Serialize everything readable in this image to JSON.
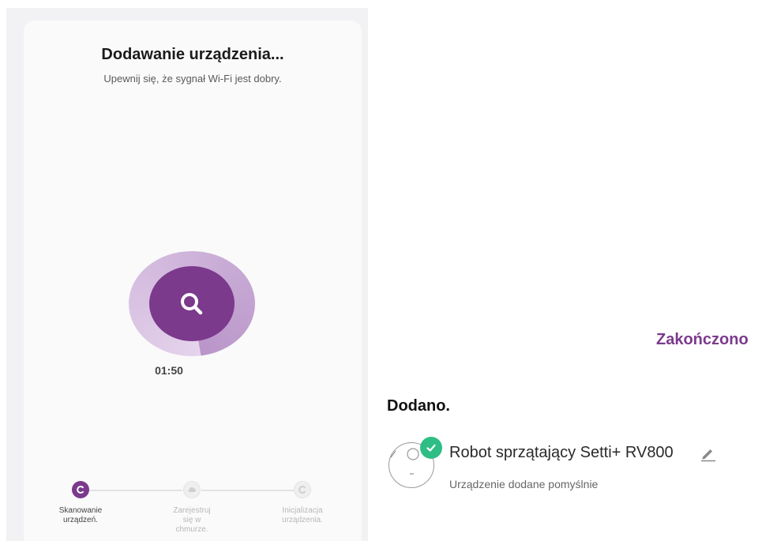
{
  "adding": {
    "title": "Dodawanie urządzenia...",
    "subtitle": "Upewnij się, że sygnał Wi-Fi jest dobry.",
    "timer": "01:50",
    "search_icon": "search-icon",
    "steps": [
      {
        "label": "Skanowanie\nurządzeń.",
        "state": "active",
        "icon": "scan-icon"
      },
      {
        "label": "Zarejestruj\nsię w\nchmurze.",
        "state": "inactive",
        "icon": "cloud-icon"
      },
      {
        "label": "Inicjalizacja\nurządzenia.",
        "state": "inactive",
        "icon": "init-icon"
      }
    ]
  },
  "result": {
    "done_label": "Zakończono",
    "added_title": "Dodano.",
    "device_name": "Robot sprzątający Setti+ RV800",
    "device_status": "Urządzenie dodane pomyślnie",
    "edit_icon": "pencil-icon",
    "success_icon": "check-icon"
  },
  "colors": {
    "accent": "#7b3a8c",
    "success": "#2ebd85"
  }
}
